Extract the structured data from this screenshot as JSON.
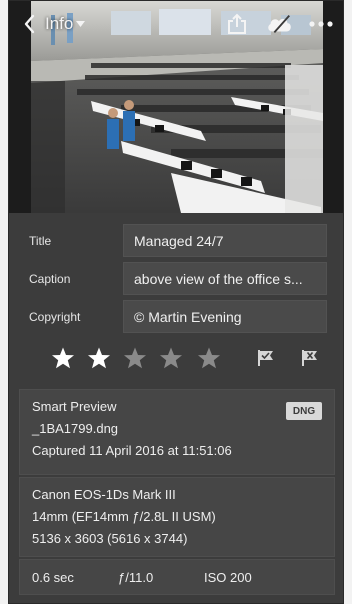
{
  "header": {
    "info_label": "Info",
    "icons": [
      "back-chevron-icon",
      "dropdown-caret-icon",
      "share-icon",
      "cloud-sync-icon",
      "more-icon"
    ]
  },
  "metadata": {
    "title_label": "Title",
    "title_value": "Managed 24/7",
    "caption_label": "Caption",
    "caption_value": "above view of the office s...",
    "copyright_label": "Copyright",
    "copyright_value": "© Martin Evening"
  },
  "rating": {
    "stars_filled": 2,
    "stars_total": 5,
    "flags": [
      "pick-flag-icon",
      "reject-flag-icon"
    ]
  },
  "file_info": {
    "preview_type": "Smart Preview",
    "badge": "DNG",
    "filename": "_1BA1799.dng",
    "captured": "Captured 11 April 2016 at 11:51:06"
  },
  "camera_info": {
    "camera": "Canon EOS-1Ds Mark III",
    "lens": "14mm (EF14mm ƒ/2.8L II USM)",
    "dimensions": "5136 x 3603 (5616 x 3744)"
  },
  "exposure": {
    "shutter": "0.6 sec",
    "aperture": "ƒ/11.0",
    "iso": "ISO 200"
  },
  "colors": {
    "panel_bg": "#3c3c3c",
    "field_bg": "#4a4a4a",
    "star_filled": "#ffffff",
    "star_empty": "#8a8a8a"
  }
}
